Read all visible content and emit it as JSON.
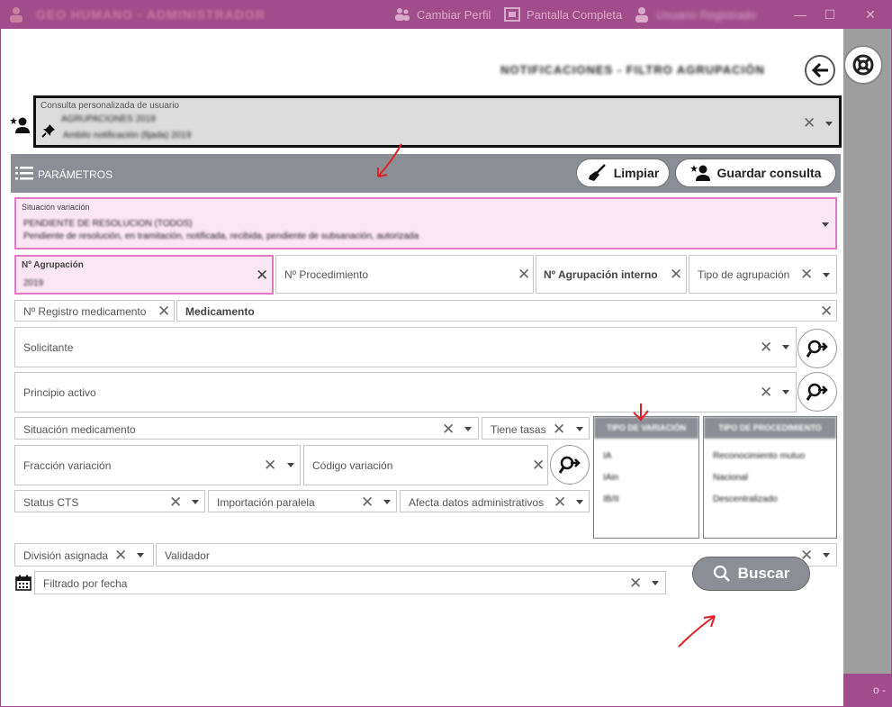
{
  "titlebar": {
    "title": "GEO HUMANO - ADMINISTRADOR",
    "change_profile": "Cambiar Perfil",
    "fullscreen": "Pantalla Completa",
    "user": "Usuario Registrado"
  },
  "background_app": {
    "footer_text": "o - PREP"
  },
  "page": {
    "title": "NOTIFICACIONES - FILTRO AGRUPACIÓN"
  },
  "custom_query": {
    "label": "Consulta personalizada de usuario",
    "line1": "AGRUPACIONES 2019",
    "line2": "Ambito notificación (fijada) 2019"
  },
  "params": {
    "title": "PARÁMETROS",
    "clear_label": "Limpiar",
    "save_label": "Guardar consulta"
  },
  "fields": {
    "situacion_variacion": {
      "label": "Situación variación",
      "value_line1": "PENDIENTE DE RESOLUCIÓN (TODOS)",
      "value_line2": "Pendiente de resolución, en tramitación, notificada, recibida, pendiente de subsanación, autorizada"
    },
    "n_agrupacion": {
      "label": "Nº Agrupación",
      "value": "2019"
    },
    "n_procedimiento": "Nº Procedimiento",
    "n_agrupacion_interno": "Nº Agrupación interno",
    "tipo_agrupacion": "Tipo de agrupación",
    "n_registro_medicamento": "Nº Registro medicamento",
    "medicamento": "Medicamento",
    "solicitante": "Solicitante",
    "principio_activo": "Principio activo",
    "situacion_medicamento": "Situación medicamento",
    "tiene_tasas": "Tiene tasas",
    "fraccion_variacion": "Fracción variación",
    "codigo_variacion": "Código variación",
    "status_cts": "Status CTS",
    "importacion_paralela": "Importación paralela",
    "afecta_datos_administrativos": "Afecta datos administrativos",
    "division_asignada": "División asignada",
    "validador": "Validador",
    "filtrado_por_fecha": "Filtrado por fecha"
  },
  "tipo_variacion": {
    "header": "TIPO DE VARIACIÓN",
    "items": [
      "IA",
      "IAin",
      "IB/II"
    ]
  },
  "tipo_procedimiento": {
    "header": "TIPO DE PROCEDIMIENTO",
    "items": [
      "Reconocimiento mutuo",
      "Nacional",
      "Descentralizado"
    ]
  },
  "search": {
    "label": "Buscar"
  },
  "colors": {
    "titlebar": "#a14d8b",
    "header_gray": "#8b8e95",
    "highlight_border": "#e07bc3",
    "highlight_bg": "#fbe6f3",
    "annotation_red": "#e01f26"
  },
  "icons": [
    "app-logo-icon",
    "profile-icon",
    "fullscreen-icon",
    "user-icon",
    "back-arrow-icon",
    "help-lifebuoy-icon",
    "add-user-star-icon",
    "pin-icon",
    "menu-list-icon",
    "broom-icon",
    "search-person-icon",
    "calendar-icon",
    "magnifier-icon"
  ]
}
